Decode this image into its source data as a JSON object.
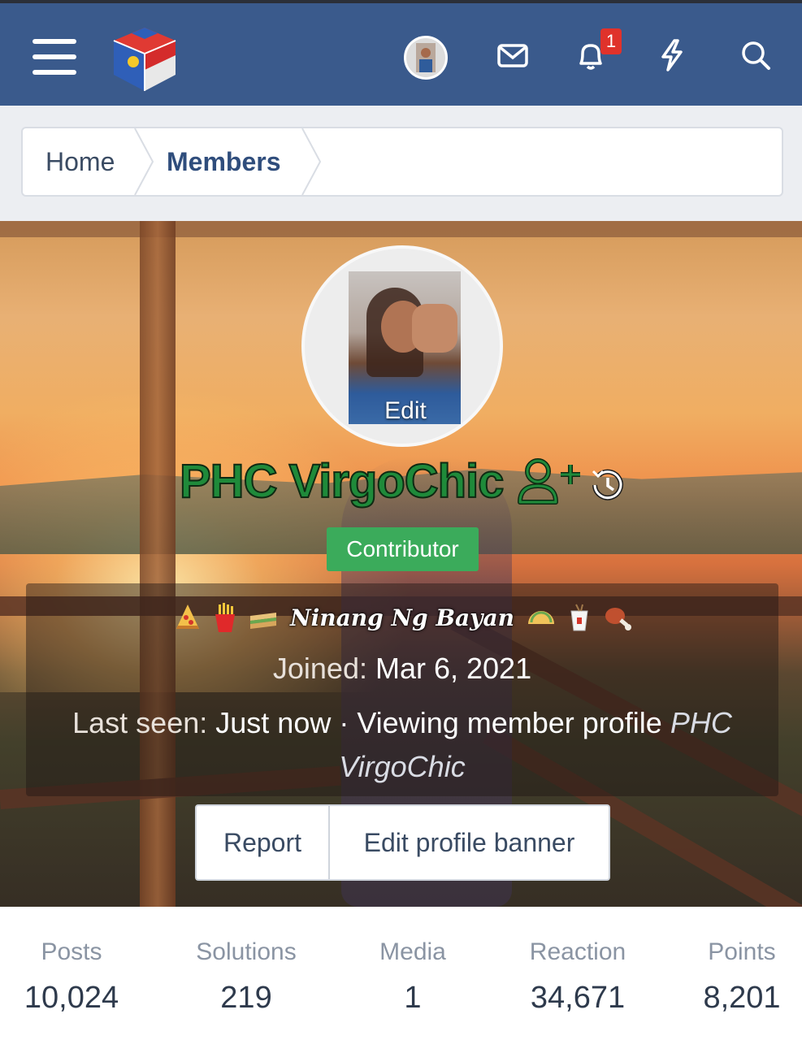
{
  "navbar": {
    "notification_count": "1",
    "icons": [
      "menu-icon",
      "site-logo",
      "user-avatar",
      "mail-icon",
      "bell-icon",
      "lightning-icon",
      "search-icon"
    ]
  },
  "breadcrumb": {
    "items": [
      {
        "label": "Home"
      },
      {
        "label": "Members"
      }
    ]
  },
  "profile": {
    "avatar_edit_label": "Edit",
    "username": "PHC VirgoChic",
    "username_color": "#1f8a3a",
    "role": "Contributor",
    "role_color": "#3bab5b",
    "custom_title": "Ninang Ng Bayan",
    "left_emojis": [
      "pizza",
      "fries",
      "sandwich"
    ],
    "right_emojis": [
      "taco",
      "takeout-box",
      "meat-on-bone"
    ],
    "joined_label": "Joined:",
    "joined_value": "Mar 6, 2021",
    "last_seen_label": "Last seen:",
    "last_seen_value": "Just now · Viewing member profile",
    "last_seen_target": "PHC VirgoChic"
  },
  "actions": {
    "report_label": "Report",
    "edit_banner_label": "Edit profile banner"
  },
  "stats": [
    {
      "label": "Posts",
      "value": "10,024"
    },
    {
      "label": "Solutions",
      "value": "219"
    },
    {
      "label": "Media",
      "value": "1"
    },
    {
      "label": "Reaction",
      "value": "34,671"
    },
    {
      "label": "Points",
      "value": "8,201"
    }
  ]
}
